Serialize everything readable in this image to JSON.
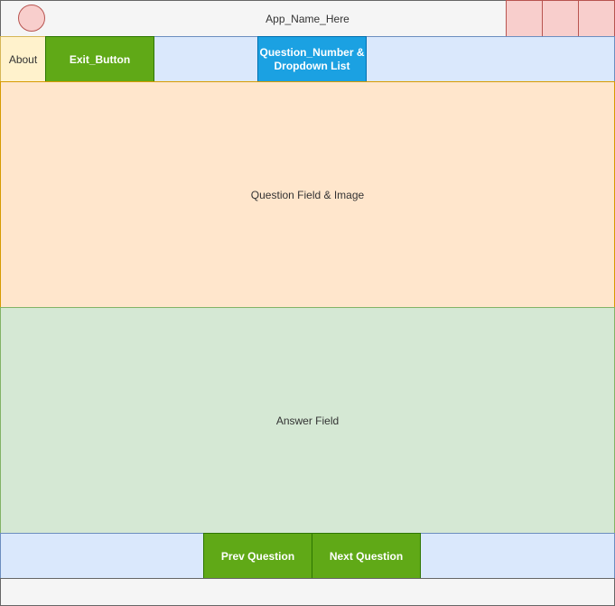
{
  "titlebar": {
    "app_name": "App_Name_Here"
  },
  "toolbar": {
    "about_label": "About",
    "exit_label": "Exit_Button",
    "question_number_label": "Question_Number &\nDropdown List"
  },
  "main": {
    "question_label": "Question Field & Image",
    "answer_label": "Answer Field"
  },
  "navigation": {
    "prev_label": "Prev Question",
    "next_label": "Next Question"
  },
  "colors": {
    "titlebar_fill": "#f5f5f5",
    "window_button_fill": "#f8cecc",
    "toolbar_fill": "#dae8fc",
    "about_fill": "#fff2cc",
    "green_button_fill": "#60a917",
    "blue_button_fill": "#1ba1e2",
    "question_fill": "#ffe6cc",
    "answer_fill": "#d5e8d4"
  }
}
